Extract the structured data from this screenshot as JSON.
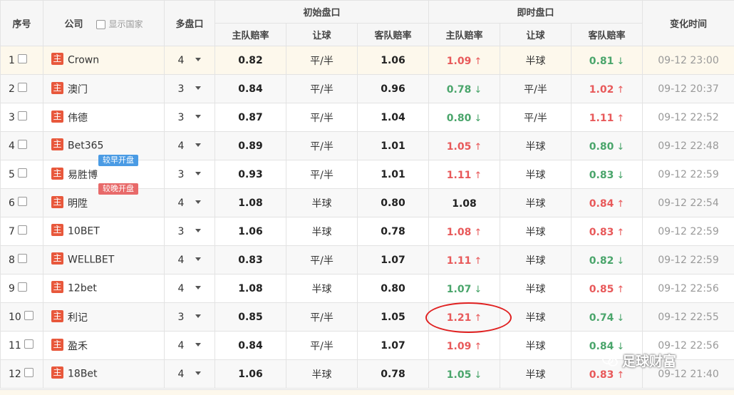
{
  "header": {
    "seq": "序号",
    "company": "公司",
    "show_country": "显示国家",
    "multi": "多盘口",
    "initial_group": "初始盘口",
    "live_group": "即时盘口",
    "change_time": "变化时间",
    "home_odds": "主队赔率",
    "handicap": "让球",
    "away_odds": "客队赔率"
  },
  "badge_zhu": "主",
  "colors": {
    "up": "#e8595a",
    "down": "#4aa56b",
    "zhu": "#e8583c",
    "tag_blue": "#4a9be4",
    "tag_red": "#e86a6a"
  },
  "rows": [
    {
      "seq": "1",
      "company": "Crown",
      "multi": "4",
      "init_home": "0.82",
      "init_hcp": "平/半",
      "init_away": "1.06",
      "live_home": "1.09",
      "live_home_dir": "up",
      "live_hcp": "半球",
      "live_away": "0.81",
      "live_away_dir": "down",
      "time": "09-12 23:00"
    },
    {
      "seq": "2",
      "company": "澳门",
      "multi": "3",
      "init_home": "0.84",
      "init_hcp": "平/半",
      "init_away": "0.96",
      "live_home": "0.78",
      "live_home_dir": "down",
      "live_hcp": "平/半",
      "live_away": "1.02",
      "live_away_dir": "up",
      "time": "09-12 20:37"
    },
    {
      "seq": "3",
      "company": "伟德",
      "multi": "3",
      "init_home": "0.87",
      "init_hcp": "平/半",
      "init_away": "1.04",
      "live_home": "0.80",
      "live_home_dir": "down",
      "live_hcp": "平/半",
      "live_away": "1.11",
      "live_away_dir": "up",
      "time": "09-12 22:52"
    },
    {
      "seq": "4",
      "company": "Bet365",
      "multi": "4",
      "init_home": "0.89",
      "init_hcp": "平/半",
      "init_away": "1.01",
      "live_home": "1.05",
      "live_home_dir": "up",
      "live_hcp": "半球",
      "live_away": "0.80",
      "live_away_dir": "down",
      "time": "09-12 22:48"
    },
    {
      "seq": "5",
      "company": "易胜博",
      "multi": "3",
      "tag": "较早开盘",
      "tag_color": "blue",
      "init_home": "0.93",
      "init_hcp": "平/半",
      "init_away": "1.01",
      "live_home": "1.11",
      "live_home_dir": "up",
      "live_hcp": "半球",
      "live_away": "0.83",
      "live_away_dir": "down",
      "time": "09-12 22:59"
    },
    {
      "seq": "6",
      "company": "明陞",
      "multi": "4",
      "tag": "较晚开盘",
      "tag_color": "red",
      "init_home": "1.08",
      "init_hcp": "半球",
      "init_away": "0.80",
      "live_home": "1.08",
      "live_home_dir": "none",
      "live_hcp": "半球",
      "live_away": "0.84",
      "live_away_dir": "up",
      "time": "09-12 22:54"
    },
    {
      "seq": "7",
      "company": "10BET",
      "multi": "3",
      "init_home": "1.06",
      "init_hcp": "半球",
      "init_away": "0.78",
      "live_home": "1.08",
      "live_home_dir": "up",
      "live_hcp": "半球",
      "live_away": "0.83",
      "live_away_dir": "up",
      "time": "09-12 22:59"
    },
    {
      "seq": "8",
      "company": "WELLBET",
      "multi": "4",
      "init_home": "0.83",
      "init_hcp": "平/半",
      "init_away": "1.07",
      "live_home": "1.11",
      "live_home_dir": "up",
      "live_hcp": "半球",
      "live_away": "0.82",
      "live_away_dir": "down",
      "time": "09-12 22:59"
    },
    {
      "seq": "9",
      "company": "12bet",
      "multi": "4",
      "init_home": "1.08",
      "init_hcp": "半球",
      "init_away": "0.80",
      "live_home": "1.07",
      "live_home_dir": "down",
      "live_hcp": "半球",
      "live_away": "0.85",
      "live_away_dir": "up",
      "time": "09-12 22:56"
    },
    {
      "seq": "10",
      "company": "利记",
      "multi": "3",
      "init_home": "0.85",
      "init_hcp": "平/半",
      "init_away": "1.05",
      "live_home": "1.21",
      "live_home_dir": "up",
      "live_hcp": "半球",
      "live_away": "0.74",
      "live_away_dir": "down",
      "time": "09-12 22:55"
    },
    {
      "seq": "11",
      "company": "盈禾",
      "multi": "4",
      "init_home": "0.84",
      "init_hcp": "平/半",
      "init_away": "1.07",
      "live_home": "1.09",
      "live_home_dir": "up",
      "live_hcp": "半球",
      "live_away": "0.84",
      "live_away_dir": "down",
      "time": "09-12 22:56"
    },
    {
      "seq": "12",
      "company": "18Bet",
      "multi": "4",
      "init_home": "1.06",
      "init_hcp": "半球",
      "init_away": "0.78",
      "live_home": "1.05",
      "live_home_dir": "down",
      "live_hcp": "半球",
      "live_away": "0.83",
      "live_away_dir": "up",
      "time": "09-12 21:40"
    }
  ],
  "watermark": "足球财富"
}
